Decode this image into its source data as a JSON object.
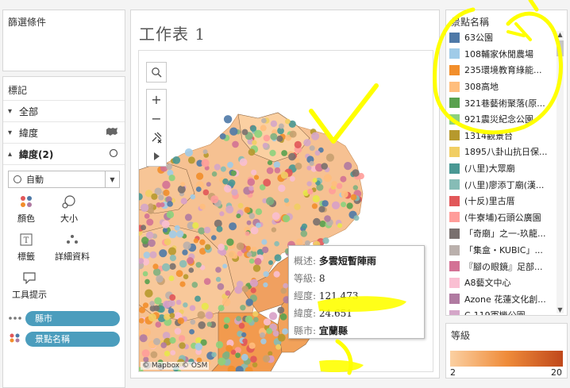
{
  "filters": {
    "title": "篩選條件"
  },
  "marks": {
    "title": "標記",
    "rows": [
      {
        "label": "全部",
        "chevron": "▾"
      },
      {
        "label": "緯度",
        "chevron": "▾",
        "icon": "map-icon"
      },
      {
        "label": "緯度(2)",
        "chevron": "▴",
        "icon": "circle-icon"
      }
    ],
    "mark_type": "自動",
    "buttons": {
      "color": "顏色",
      "size": "大小",
      "label": "標籤",
      "detail": "詳細資料",
      "tooltip": "工具提示"
    },
    "pills": [
      {
        "label": "縣市",
        "icon": "detail-icon"
      },
      {
        "label": "景點名稱",
        "icon": "color-icon"
      }
    ]
  },
  "sheet": {
    "title": "工作表 1",
    "attribution": "© Mapbox © OSM"
  },
  "tooltip": {
    "rows": [
      {
        "key": "概述:",
        "value": "多雲短暫陣雨"
      },
      {
        "key": "等級:",
        "value": "8"
      },
      {
        "key": "經度:",
        "value": "121.473"
      },
      {
        "key": "緯度:",
        "value": "24.651"
      },
      {
        "key": "縣市:",
        "value": "宜蘭縣"
      }
    ]
  },
  "legend": {
    "title": "景點名稱",
    "items": [
      {
        "label": "63公園",
        "color": "#4e79a7"
      },
      {
        "label": "108輔家休閒農場",
        "color": "#a0cbe8"
      },
      {
        "label": "235環境教育綠能...",
        "color": "#f28e2b"
      },
      {
        "label": "308高地",
        "color": "#ffbe7d"
      },
      {
        "label": "321巷藝術聚落(原...",
        "color": "#59a14f"
      },
      {
        "label": "921震災紀念公園",
        "color": "#8cd17d"
      },
      {
        "label": "1314觀景台",
        "color": "#b6992d"
      },
      {
        "label": "1895八卦山抗日保...",
        "color": "#f1ce63"
      },
      {
        "label": "(八里)大眾廟",
        "color": "#499894"
      },
      {
        "label": "(八里)廖添丁廟(漢...",
        "color": "#86bcb6"
      },
      {
        "label": "(十反)里古厝",
        "color": "#e15759"
      },
      {
        "label": "(牛寮埔)石頭公廣園",
        "color": "#ff9d9a"
      },
      {
        "label": "「奇廟」之一-玖龍...",
        "color": "#79706e"
      },
      {
        "label": "「集盒・KUBIC」...",
        "color": "#bab0ac"
      },
      {
        "label": "『腳の眼鏡』足部...",
        "color": "#d37295"
      },
      {
        "label": "A8藝文中心",
        "color": "#fabfd2"
      },
      {
        "label": "Azone 花蓮文化創...",
        "color": "#b07aa1"
      },
      {
        "label": "C-119軍機公園",
        "color": "#d4a6c8"
      }
    ]
  },
  "grade": {
    "title": "等級",
    "min": "2",
    "max": "20"
  },
  "colors": {
    "pill": "#4b9dbd",
    "annotation": "#ffff00"
  }
}
